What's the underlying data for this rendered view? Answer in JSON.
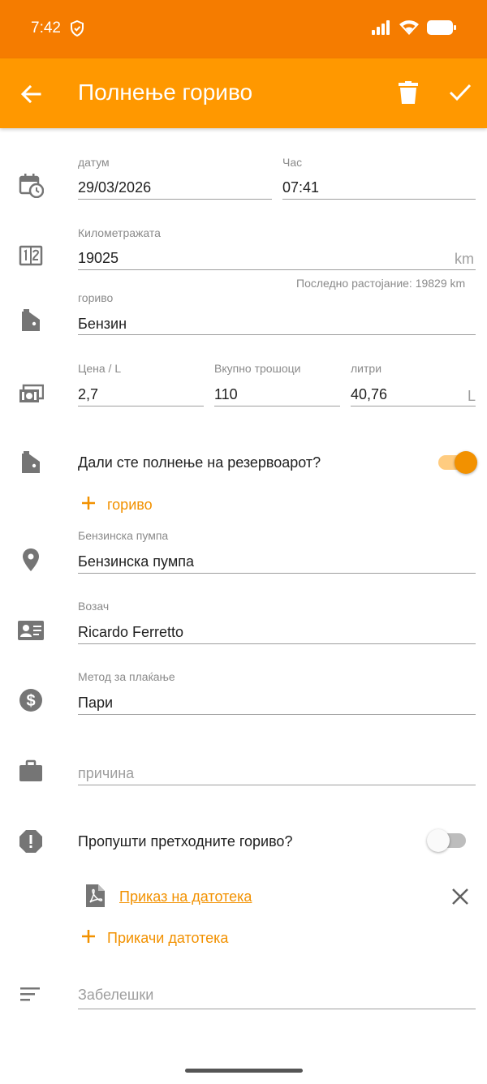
{
  "status_bar": {
    "time": "7:42"
  },
  "app_bar": {
    "title": "Полнење гориво"
  },
  "form": {
    "date": {
      "label": "датум",
      "value": "29/03/2026"
    },
    "time": {
      "label": "Час",
      "value": "07:41"
    },
    "odometer": {
      "label": "Километражата",
      "value": "19025",
      "unit": "km",
      "hint": "Последно растојание: 19829 km"
    },
    "fuel": {
      "label": "гориво",
      "value": "Бензин"
    },
    "price": {
      "label": "Цена / L",
      "value": "2,7"
    },
    "total": {
      "label": "Вкупно трошоци",
      "value": "110"
    },
    "liters": {
      "label": "литри",
      "value": "40,76",
      "unit": "L"
    },
    "full_tank": {
      "label": "Дали сте полнење на резервоарот?",
      "on": true
    },
    "add_fuel": {
      "label": "гориво"
    },
    "station": {
      "label": "Бензинска пумпа",
      "value": "Бензинска пумпа"
    },
    "driver": {
      "label": "Возач",
      "value": "Ricardo Ferretto"
    },
    "payment": {
      "label": "Метод за плаќање",
      "value": "Пари"
    },
    "reason": {
      "placeholder": "причина"
    },
    "skip_previous": {
      "label": "Пропушти претходните гориво?",
      "on": false
    },
    "attachment": {
      "label": "Приказ на датотека"
    },
    "attach_file": {
      "label": "Прикачи датотека"
    },
    "notes": {
      "placeholder": "Забелешки"
    }
  },
  "colors": {
    "accent": "#ff9800",
    "status_bar": "#f57c00",
    "action": "#f29100",
    "icon_gray": "#757575"
  }
}
